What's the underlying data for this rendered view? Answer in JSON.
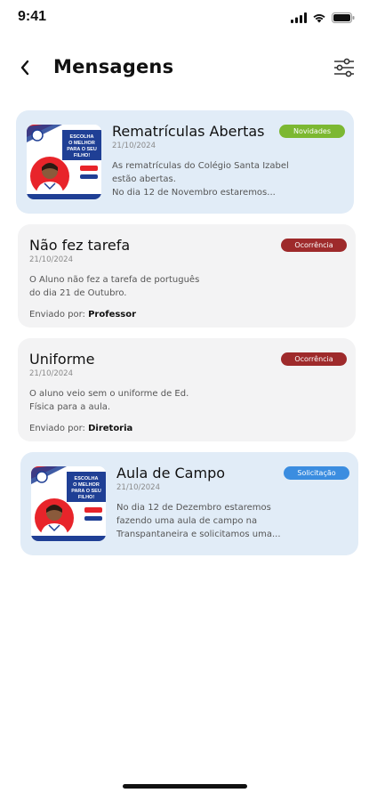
{
  "status_bar": {
    "time": "9:41"
  },
  "header": {
    "title": "Mensagens"
  },
  "messages": [
    {
      "title": "Rematrículas Abertas",
      "date": "21/10/2024",
      "body_line1": "As rematrículas do Colégio Santa Izabel",
      "body_line2": "estão abertas.",
      "body_line3": "No dia 12 de Novembro estaremos...",
      "badge": "Novidades",
      "badge_color": "#7cb832",
      "thumb_text": [
        "ESCOLHA",
        "O MELHOR",
        "PARA O SEU",
        "FILHO!"
      ]
    },
    {
      "title": "Não fez tarefa",
      "date": "21/10/2024",
      "body_line1": "O Aluno não fez a tarefa de português",
      "body_line2": "do dia 21 de Outubro.",
      "sender_label": "Enviado por:",
      "sender_name": "Professor",
      "badge": "Ocorrência",
      "badge_color": "#9e2a2b"
    },
    {
      "title": "Uniforme",
      "date": "21/10/2024",
      "body_line1": "O aluno veio sem o uniforme de Ed.",
      "body_line2": "Física para a aula.",
      "sender_label": "Enviado por:",
      "sender_name": "Diretoria",
      "badge": "Ocorrência",
      "badge_color": "#9e2a2b"
    },
    {
      "title": "Aula de Campo",
      "date": "21/10/2024",
      "body_line1": "No dia 12 de Dezembro estaremos",
      "body_line2": "fazendo uma aula de campo na",
      "body_line3": "Transpantaneira e solicitamos uma...",
      "badge": "Solicitação",
      "badge_color": "#3b8de0",
      "thumb_text": [
        "ESCOLHA",
        "O MELHOR",
        "PARA O SEU",
        "FILHO!"
      ]
    }
  ]
}
